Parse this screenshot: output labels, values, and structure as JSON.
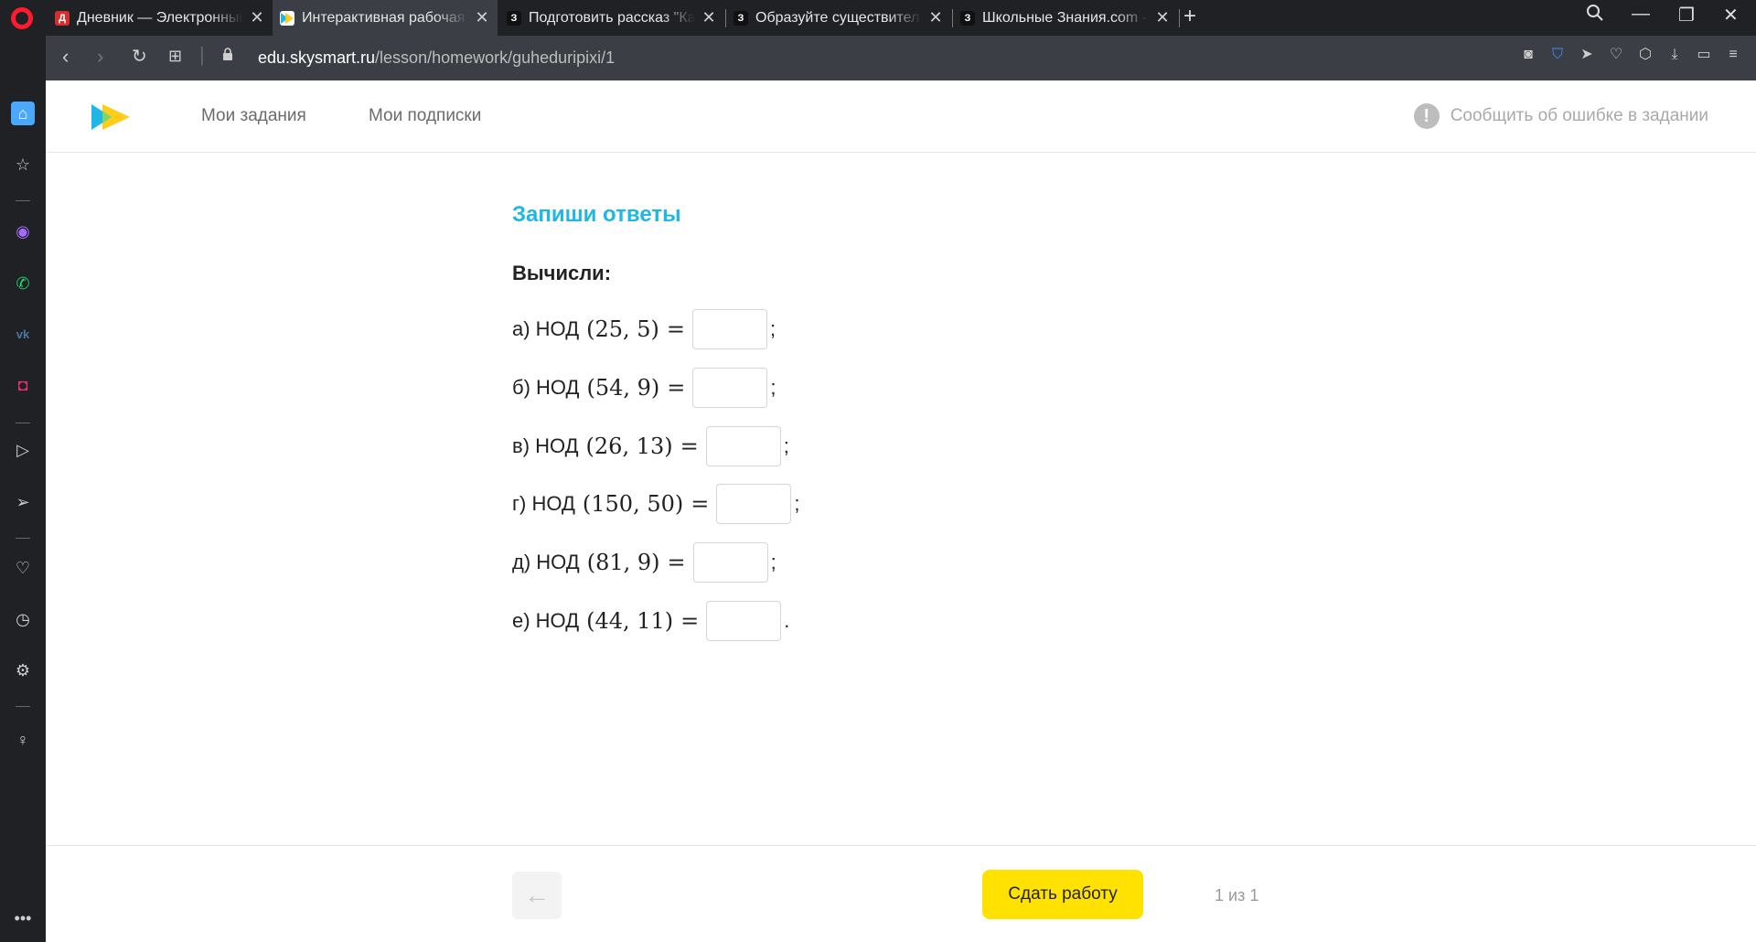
{
  "browser": {
    "tabs": [
      {
        "title": "Дневник — Электронный",
        "favicon_letter": "Д",
        "favicon_color": "#d32f2f",
        "active": false
      },
      {
        "title": "Интерактивная рабочая т",
        "favicon_letter": "",
        "favicon_color": "#ffffff",
        "active": true
      },
      {
        "title": "Подготовить рассказ \"Как",
        "favicon_letter": "З",
        "favicon_color": "#111111",
        "active": false
      },
      {
        "title": "Образуйте существительн",
        "favicon_letter": "З",
        "favicon_color": "#111111",
        "active": false
      },
      {
        "title": "Школьные Знания.com - Р",
        "favicon_letter": "З",
        "favicon_color": "#111111",
        "active": false
      }
    ],
    "url_host": "edu.skysmart.ru",
    "url_path": "/lesson/homework/guheduripixi/1"
  },
  "header": {
    "nav": [
      "Мои задания",
      "Мои подписки"
    ],
    "report_label": "Сообщить об ошибке в задании"
  },
  "task": {
    "title": "Запиши ответы",
    "subtitle": "Вычисли:",
    "rows": [
      {
        "label": "а) НОД",
        "args": "(25, 5)",
        "value": "",
        "end": ";"
      },
      {
        "label": "б) НОД",
        "args": "(54, 9)",
        "value": "",
        "end": ";"
      },
      {
        "label": "в) НОД",
        "args": "(26, 13)",
        "value": "",
        "end": ";"
      },
      {
        "label": "г) НОД",
        "args": "(150, 50)",
        "value": "",
        "end": ";"
      },
      {
        "label": "д) НОД",
        "args": "(81, 9)",
        "value": "",
        "end": ";"
      },
      {
        "label": "е) НОД",
        "args": "(44, 11)",
        "value": "",
        "end": "."
      }
    ],
    "equals": "="
  },
  "footer": {
    "back_icon": "←",
    "submit_label": "Сдать работу",
    "pager": "1 из 1"
  },
  "colors": {
    "accent": "#1fb8e6",
    "submit": "#ffe200"
  }
}
